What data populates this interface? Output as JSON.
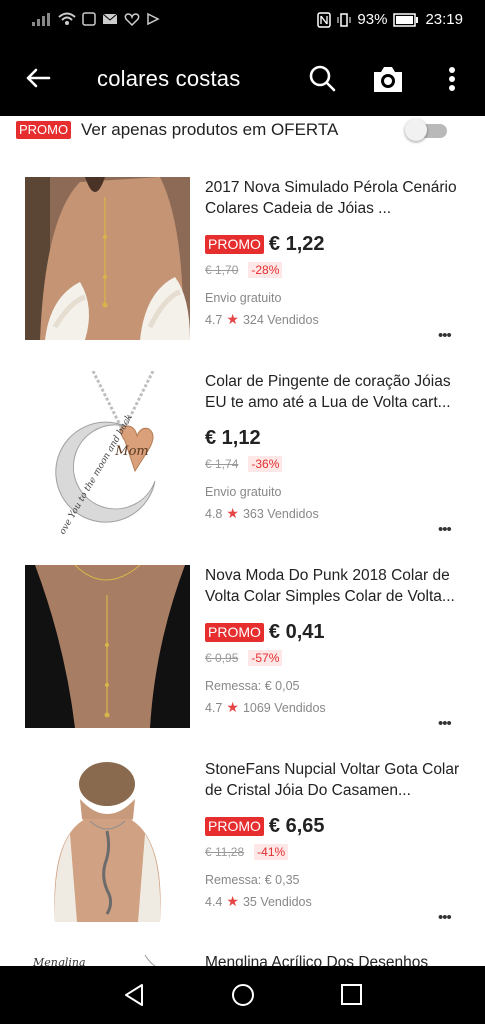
{
  "status": {
    "battery": "93%",
    "time": "23:19"
  },
  "appbar": {
    "title": "colares costas"
  },
  "filter": {
    "promo_tag": "PROMO",
    "label": "Ver apenas produtos em OFERTA",
    "enabled": false
  },
  "products": [
    {
      "name": "2017 Nova Simulado Pérola Cenário Colares Cadeia de Jóias ...",
      "promo": "PROMO",
      "price": "€ 1,22",
      "old_price": "€ 1,70",
      "discount": "-28%",
      "shipping": "Envio gratuito",
      "rating": "4.7",
      "sold": "324 Vendidos"
    },
    {
      "name": "Colar de Pingente de coração Jóias EU te amo até a Lua de Volta cart...",
      "promo": "",
      "price": "€ 1,12",
      "old_price": "€ 1,74",
      "discount": "-36%",
      "shipping": "Envio gratuito",
      "rating": "4.8",
      "sold": "363 Vendidos",
      "img_text": "I Love You to the moon and back",
      "img_heart": "Mom"
    },
    {
      "name": "Nova Moda Do Punk 2018 Colar de Volta Colar Simples Colar de Volta...",
      "promo": "PROMO",
      "price": "€ 0,41",
      "old_price": "€ 0,95",
      "discount": "-57%",
      "shipping": "Remessa: € 0,05",
      "rating": "4.7",
      "sold": "1069 Vendidos"
    },
    {
      "name": "StoneFans Nupcial Voltar Gota Colar de Cristal Jóia Do Casamen...",
      "promo": "PROMO",
      "price": "€ 6,65",
      "old_price": "€ 11,28",
      "discount": "-41%",
      "shipping": "Remessa: € 0,35",
      "rating": "4.4",
      "sold": "35 Vendidos"
    },
    {
      "name": "Menglina Acrílico Dos Desenhos",
      "img_text": "Menglina"
    }
  ]
}
